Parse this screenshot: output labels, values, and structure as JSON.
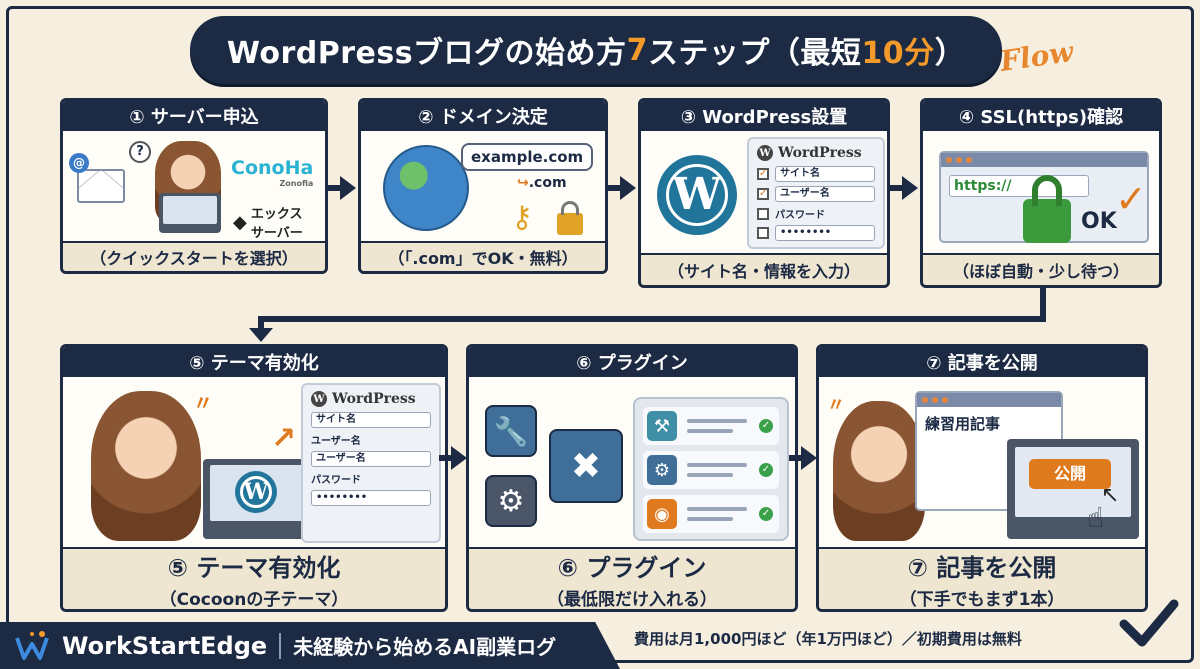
{
  "title": {
    "main": "WordPressブログの始め方",
    "num": "7",
    "steps": "ステップ（最短",
    "time": "10分",
    "close": "）"
  },
  "flow_label": "Flow",
  "steps": [
    {
      "head": "① サーバー申込",
      "foot": "（クイックスタートを選択）",
      "art": {
        "brand1": "ConoHa",
        "brand1_sub": "Zonofia",
        "brand2_line1": "エックス",
        "brand2_line2": "サーバー",
        "mail_icon": "@",
        "question": "?"
      }
    },
    {
      "head": "② ドメイン決定",
      "foot": "（「.com」でOK・無料）",
      "art": {
        "domain": "example.com",
        "tld": ".com"
      }
    },
    {
      "head": "③ WordPress設置",
      "foot": "（サイト名・情報を入力）",
      "art": {
        "brand": "WordPress",
        "fields": [
          "サイト名",
          "ユーザー名",
          "パスワード",
          "••••••••"
        ]
      }
    },
    {
      "head": "④ SSL(https)確認",
      "foot": "（ほぼ自動・少し待つ）",
      "art": {
        "url": "https://",
        "ok": "OK"
      }
    },
    {
      "head": "⑤ テーマ有効化",
      "foot_big": "⑤ テーマ有効化",
      "foot_small": "（Cocoonの子テーマ）",
      "art": {
        "brand": "WordPress",
        "fields": [
          "サイト名",
          "ユーザー名",
          "ユーザー名",
          "パスワード",
          "••••••••"
        ]
      }
    },
    {
      "head": "⑥ プラグイン",
      "foot_big": "⑥ プラグイン",
      "foot_small": "（最低限だけ入れる）",
      "art": {}
    },
    {
      "head": "⑦ 記事を公開",
      "foot_big": "⑦ 記事を公開",
      "foot_small": "（下手でもまず1本）",
      "art": {
        "article": "練習用記事",
        "publish": "公開"
      }
    }
  ],
  "footer": {
    "brand": "WorkStartEdge",
    "tagline": "未経験から始めるAI副業ログ",
    "cost": "費用は月1,000円ほど（年1万円ほど）／初期費用は無料"
  },
  "colors": {
    "navy": "#1c2a44",
    "accent": "#f39a2b",
    "cream": "#f6efe0",
    "wp_blue": "#21759b",
    "ok_green": "#3ba04a"
  }
}
